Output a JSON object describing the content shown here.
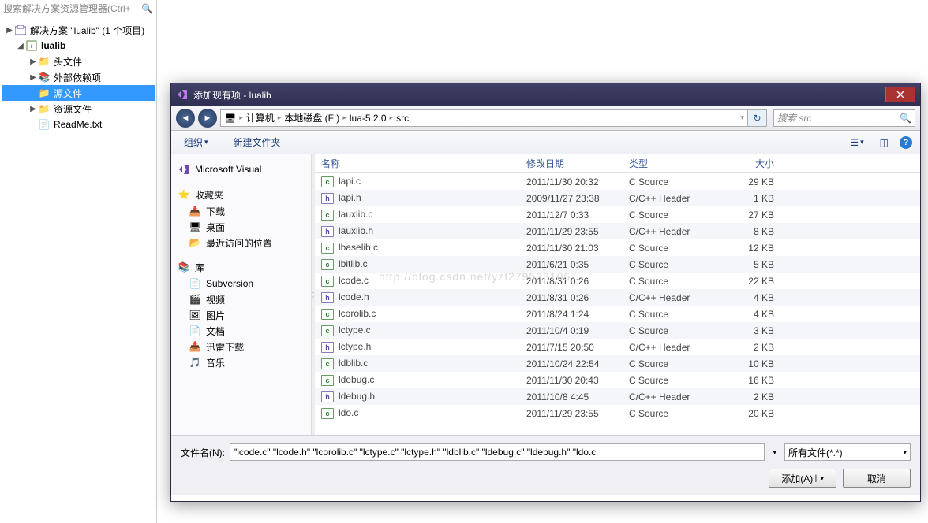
{
  "sol_search_placeholder": "搜索解决方案资源管理器(Ctrl+",
  "solution_label": "解决方案 \"lualib\" (1 个项目)",
  "project_name": "lualib",
  "folders": {
    "header_files": "头文件",
    "external_deps": "外部依赖项",
    "source_files": "源文件",
    "resource_files": "资源文件"
  },
  "readme": "ReadMe.txt",
  "dialog": {
    "title": "添加现有项 - lualib",
    "breadcrumb": [
      "计算机",
      "本地磁盘 (F:)",
      "lua-5.2.0",
      "src"
    ],
    "search_placeholder": "搜索 src",
    "organize": "组织",
    "new_folder": "新建文件夹",
    "sidebar": {
      "vs": "Microsoft Visual",
      "favorites": "收藏夹",
      "downloads": "下载",
      "desktop": "桌面",
      "recent": "最近访问的位置",
      "libraries": "库",
      "subversion": "Subversion",
      "videos": "视频",
      "pictures": "图片",
      "documents": "文档",
      "xunlei": "迅雷下载",
      "music": "音乐"
    },
    "columns": {
      "name": "名称",
      "date": "修改日期",
      "type": "类型",
      "size": "大小"
    },
    "files": [
      {
        "name": "lapi.c",
        "date": "2011/11/30 20:32",
        "type": "C Source",
        "size": "29 KB",
        "ext": "c"
      },
      {
        "name": "lapi.h",
        "date": "2009/11/27 23:38",
        "type": "C/C++ Header",
        "size": "1 KB",
        "ext": "h"
      },
      {
        "name": "lauxlib.c",
        "date": "2011/12/7 0:33",
        "type": "C Source",
        "size": "27 KB",
        "ext": "c"
      },
      {
        "name": "lauxlib.h",
        "date": "2011/11/29 23:55",
        "type": "C/C++ Header",
        "size": "8 KB",
        "ext": "h"
      },
      {
        "name": "lbaselib.c",
        "date": "2011/11/30 21:03",
        "type": "C Source",
        "size": "12 KB",
        "ext": "c"
      },
      {
        "name": "lbitlib.c",
        "date": "2011/6/21 0:35",
        "type": "C Source",
        "size": "5 KB",
        "ext": "c"
      },
      {
        "name": "lcode.c",
        "date": "2011/8/31 0:26",
        "type": "C Source",
        "size": "22 KB",
        "ext": "c"
      },
      {
        "name": "lcode.h",
        "date": "2011/8/31 0:26",
        "type": "C/C++ Header",
        "size": "4 KB",
        "ext": "h"
      },
      {
        "name": "lcorolib.c",
        "date": "2011/8/24 1:24",
        "type": "C Source",
        "size": "4 KB",
        "ext": "c"
      },
      {
        "name": "lctype.c",
        "date": "2011/10/4 0:19",
        "type": "C Source",
        "size": "3 KB",
        "ext": "c"
      },
      {
        "name": "lctype.h",
        "date": "2011/7/15 20:50",
        "type": "C/C++ Header",
        "size": "2 KB",
        "ext": "h"
      },
      {
        "name": "ldblib.c",
        "date": "2011/10/24 22:54",
        "type": "C Source",
        "size": "10 KB",
        "ext": "c"
      },
      {
        "name": "ldebug.c",
        "date": "2011/11/30 20:43",
        "type": "C Source",
        "size": "16 KB",
        "ext": "c"
      },
      {
        "name": "ldebug.h",
        "date": "2011/10/8 4:45",
        "type": "C/C++ Header",
        "size": "2 KB",
        "ext": "h"
      },
      {
        "name": "ldo.c",
        "date": "2011/11/29 23:55",
        "type": "C Source",
        "size": "20 KB",
        "ext": "c"
      }
    ],
    "filename_label": "文件名(N):",
    "filename_value": "\"lcode.c\" \"lcode.h\" \"lcorolib.c\" \"lctype.c\" \"lctype.h\" \"ldblib.c\" \"ldebug.c\" \"ldebug.h\" \"ldo.c",
    "filter": "所有文件(*.*)",
    "add_btn": "添加(A)",
    "cancel_btn": "取消"
  },
  "watermark": "http://blog.csdn.net/yzf279533105"
}
